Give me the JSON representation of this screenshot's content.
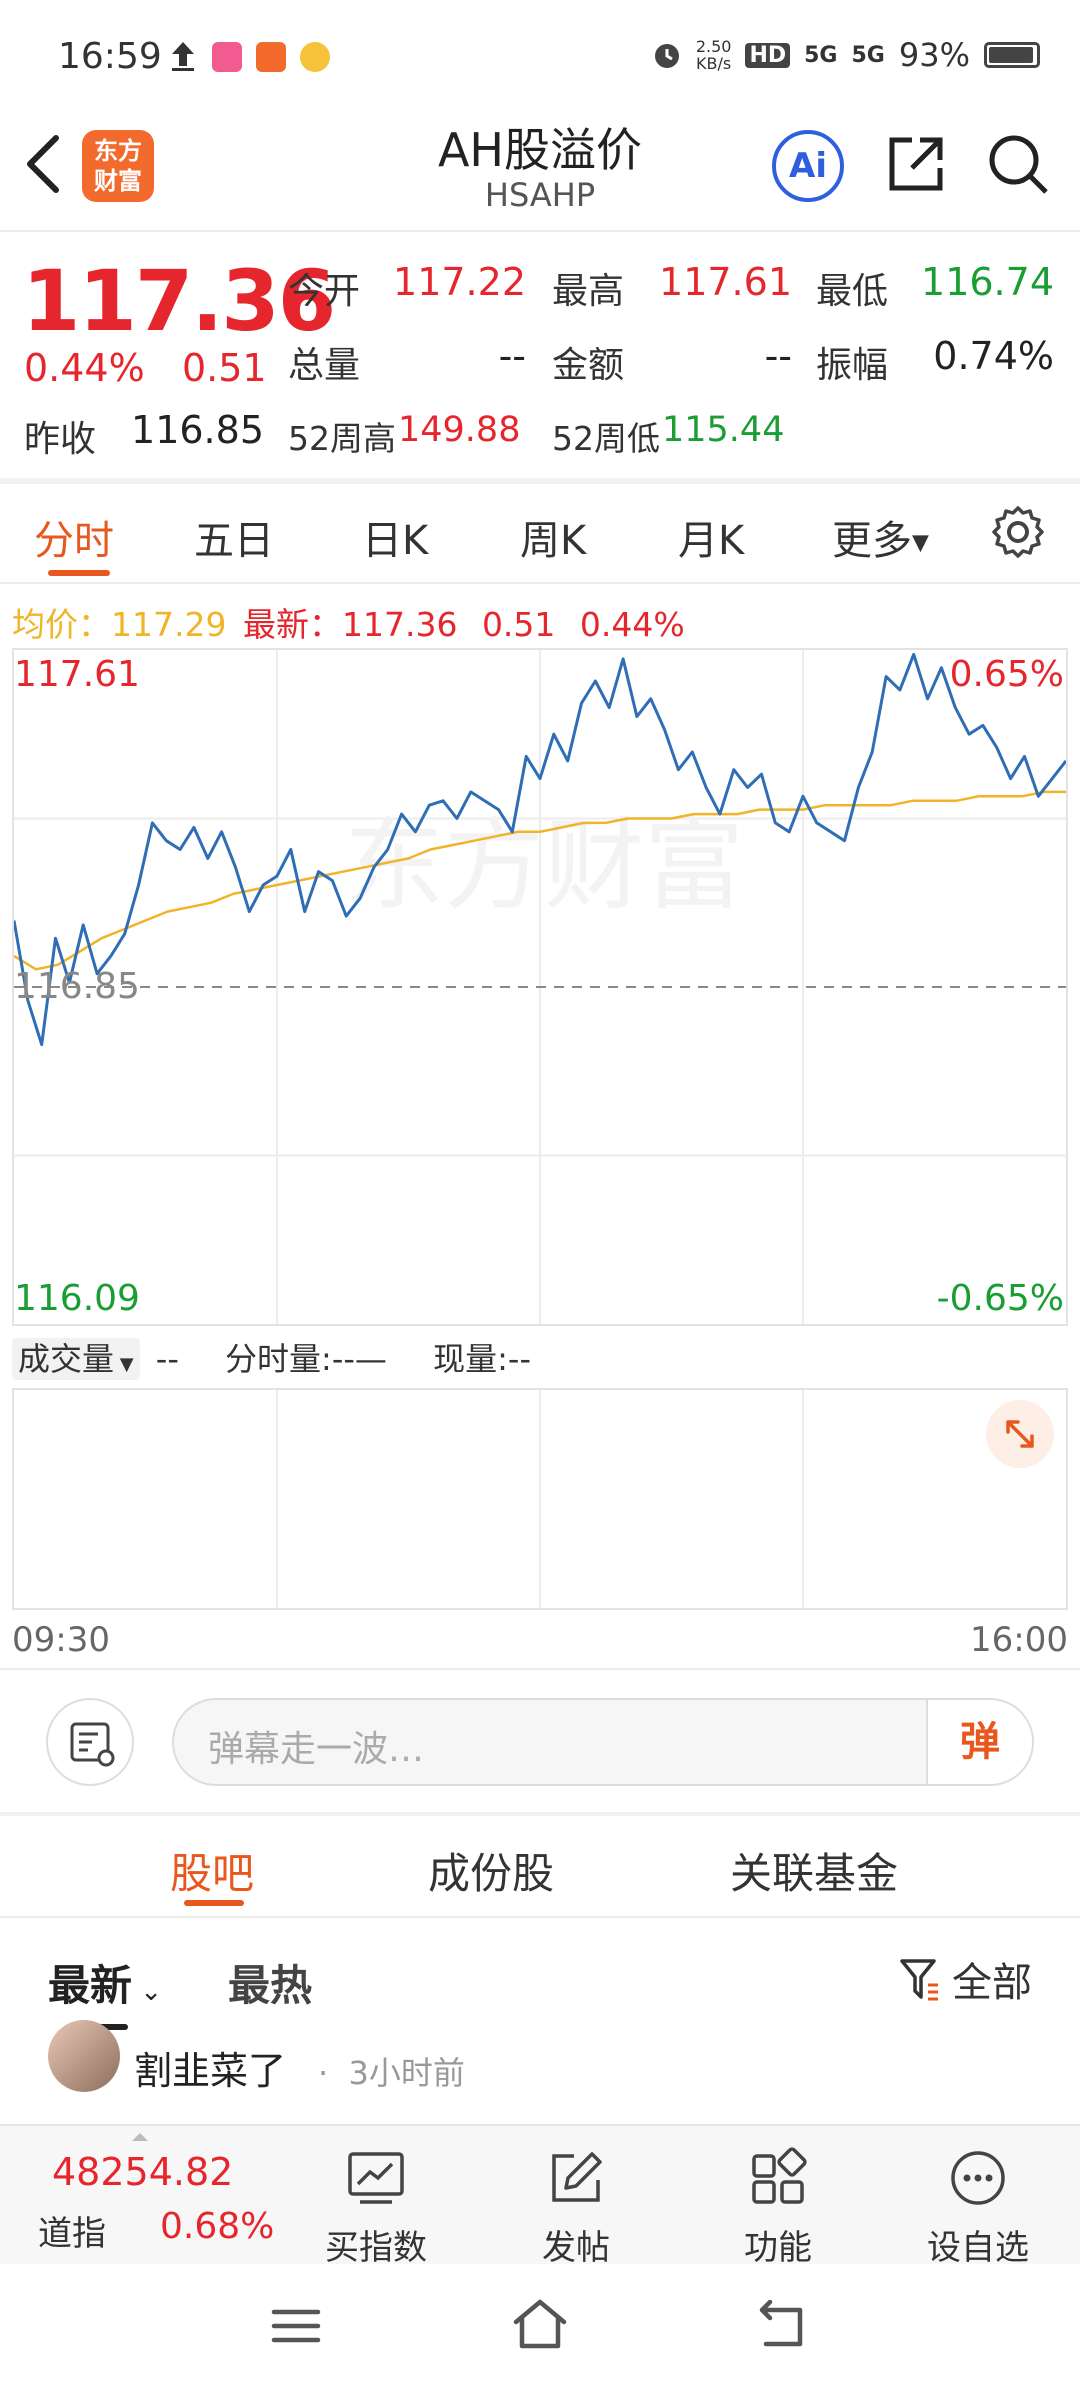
{
  "status_bar": {
    "time": "16:59",
    "network_speed_value": "2.50",
    "network_speed_unit": "KB/s",
    "hd_label": "HD",
    "signal1": "5G",
    "signal2": "5G",
    "battery": "93%"
  },
  "header": {
    "logo_line1": "东方",
    "logo_line2": "财富",
    "title": "AH股溢价",
    "code": "HSAHP",
    "ai_label": "Ai"
  },
  "quote": {
    "price": "117.36",
    "change_pct": "0.44%",
    "change_amt": "0.51",
    "open_label": "今开",
    "open": "117.22",
    "high_label": "最高",
    "high": "117.61",
    "low_label": "最低",
    "low": "116.74",
    "volume_label": "总量",
    "volume": "--",
    "amount_label": "金额",
    "amount": "--",
    "amplitude_label": "振幅",
    "amplitude": "0.74%",
    "prev_close_label": "昨收",
    "prev_close": "116.85",
    "high52_label": "52周高",
    "high52": "149.88",
    "low52_label": "52周低",
    "low52": "115.44"
  },
  "tabs": [
    "分时",
    "五日",
    "日K",
    "周K",
    "月K",
    "更多"
  ],
  "chart_info": {
    "avg_label": "均价：",
    "avg": "117.29",
    "latest_label": "最新：",
    "latest": "117.36",
    "chg": "0.51",
    "pct": "0.44%"
  },
  "chart_labels": {
    "y_max": "117.61",
    "y_mid": "116.85",
    "y_min": "116.09",
    "pct_max": "0.65%",
    "pct_min": "-0.65%",
    "watermark": "东方财富",
    "time_start": "09:30",
    "time_end": "16:00"
  },
  "chart_data": {
    "type": "line",
    "ylim": [
      116.09,
      117.61
    ],
    "reference_line": 116.85,
    "xlabel_start": "09:30",
    "xlabel_end": "16:00",
    "grid": true,
    "series": [
      {
        "values": [
          117.0,
          116.82,
          116.72,
          116.96,
          116.86,
          116.99,
          116.88,
          116.92,
          116.97,
          117.08,
          117.22,
          117.18,
          117.16,
          117.21,
          117.14,
          117.2,
          117.12,
          117.02,
          117.08,
          117.1,
          117.16,
          117.02,
          117.11,
          117.09,
          117.01,
          117.05,
          117.12,
          117.16,
          117.24,
          117.2,
          117.26,
          117.27,
          117.23,
          117.29,
          117.27,
          117.25,
          117.2,
          117.37,
          117.32,
          117.42,
          117.36,
          117.49,
          117.54,
          117.48,
          117.59,
          117.46,
          117.5,
          117.43,
          117.34,
          117.38,
          117.3,
          117.24,
          117.34,
          117.3,
          117.33,
          117.22,
          117.2,
          117.28,
          117.22,
          117.2,
          117.18,
          117.3,
          117.38,
          117.55,
          117.52,
          117.6,
          117.5,
          117.57,
          117.48,
          117.42,
          117.44,
          117.39,
          117.32,
          117.37,
          117.28,
          117.32,
          117.36
        ]
      },
      {
        "values": [
          116.92,
          116.89,
          116.9,
          116.93,
          116.96,
          116.98,
          117.0,
          117.02,
          117.03,
          117.04,
          117.06,
          117.07,
          117.08,
          117.09,
          117.1,
          117.11,
          117.12,
          117.13,
          117.14,
          117.16,
          117.17,
          117.18,
          117.19,
          117.2,
          117.2,
          117.21,
          117.22,
          117.22,
          117.23,
          117.23,
          117.23,
          117.24,
          117.24,
          117.24,
          117.25,
          117.25,
          117.25,
          117.26,
          117.26,
          117.26,
          117.26,
          117.27,
          117.27,
          117.27,
          117.28,
          117.28,
          117.28,
          117.29,
          117.29
        ]
      }
    ]
  },
  "volume": {
    "dropdown_label": "成交量",
    "dropdown_value": "--",
    "minute_label": "分时量:",
    "minute_value": "--—",
    "current_label": "现量:",
    "current_value": "--"
  },
  "danmu": {
    "placeholder": "弹幕走一波…",
    "button": "弹"
  },
  "community_tabs": [
    "股吧",
    "成份股",
    "关联基金"
  ],
  "sort": {
    "latest": "最新",
    "hot": "最热",
    "filter": "全部"
  },
  "post": {
    "user": "割韭菜了",
    "time": "3小时前"
  },
  "bottom_bar": {
    "index_value": "48254.82",
    "index_name": "道指",
    "index_pct": "0.68%",
    "items": [
      "买指数",
      "发帖",
      "功能",
      "设自选"
    ]
  },
  "colors": {
    "up": "#e5262c",
    "down": "#1a9e33",
    "accent": "#e8581e",
    "price_line": "#2f6db5",
    "avg_line": "#f0b429"
  }
}
